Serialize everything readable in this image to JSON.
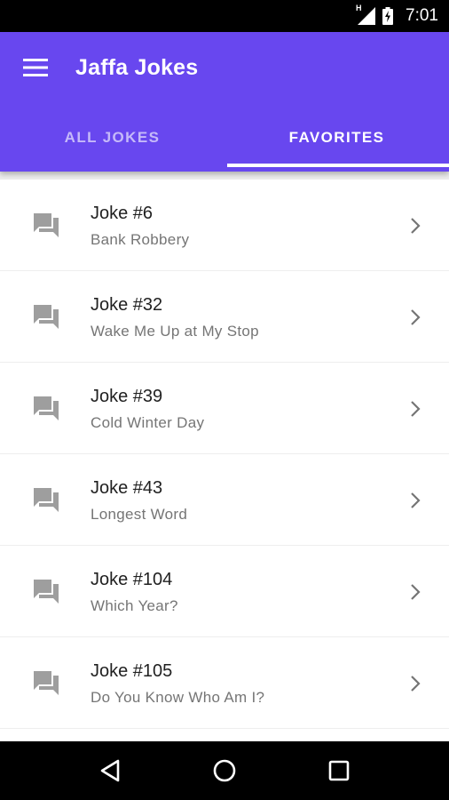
{
  "status_bar": {
    "time": "7:01",
    "network": "H"
  },
  "app": {
    "title": "Jaffa Jokes"
  },
  "tabs": [
    {
      "label": "ALL JOKES",
      "active": false
    },
    {
      "label": "FAVORITES",
      "active": true
    }
  ],
  "favorites": [
    {
      "title": "Joke #6",
      "subtitle": "Bank Robbery"
    },
    {
      "title": "Joke #32",
      "subtitle": "Wake Me Up at My Stop"
    },
    {
      "title": "Joke #39",
      "subtitle": "Cold Winter Day"
    },
    {
      "title": "Joke #43",
      "subtitle": "Longest Word"
    },
    {
      "title": "Joke #104",
      "subtitle": "Which Year?"
    },
    {
      "title": "Joke #105",
      "subtitle": "Do You Know Who Am I?"
    }
  ],
  "icons": {
    "menu": "menu-icon",
    "list_item": "chat-bubbles-icon",
    "row_action": "chevron-right-icon",
    "nav": [
      "back-icon",
      "home-icon",
      "recents-icon"
    ]
  },
  "colors": {
    "app_bar": "#6847ef",
    "background": "#eeeeee",
    "icon_gray": "#9e9e9e"
  }
}
